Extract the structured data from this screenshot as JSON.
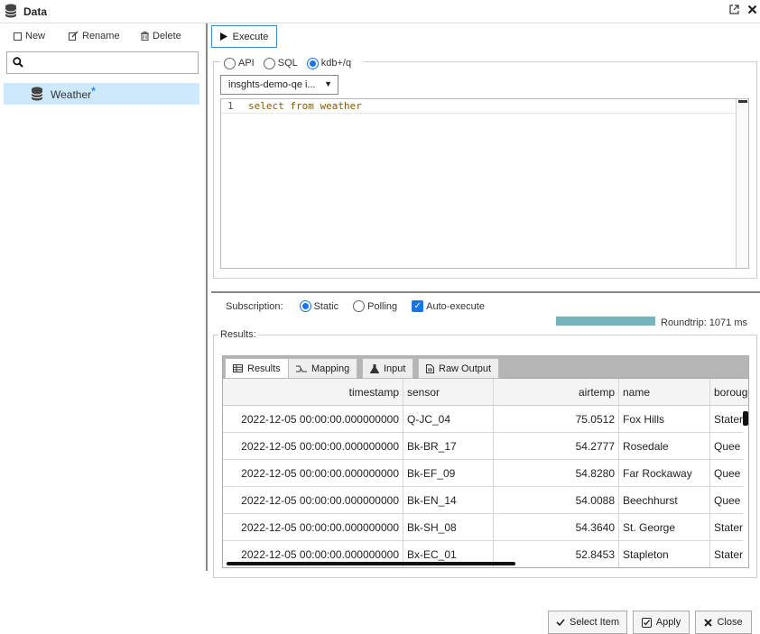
{
  "window": {
    "title": "Data",
    "popout_icon": "external-link-icon",
    "close_icon": "close-icon"
  },
  "sidebar": {
    "toolbar": {
      "new_label": "New",
      "rename_label": "Rename",
      "delete_label": "Delete"
    },
    "search": {
      "value": "",
      "placeholder": ""
    },
    "items": [
      {
        "label": "Weather",
        "modified_marker": "*",
        "icon": "database-icon",
        "selected": true
      }
    ]
  },
  "query": {
    "execute_label": "Execute",
    "modes": [
      {
        "label": "API",
        "selected": false
      },
      {
        "label": "SQL",
        "selected": false
      },
      {
        "label": "kdb+/q",
        "selected": true
      }
    ],
    "connection": "insghts-demo-qe i...",
    "editor": {
      "line_number": "1",
      "code": "select from weather"
    }
  },
  "subscription": {
    "label": "Subscription:",
    "static_label": "Static",
    "polling_label": "Polling",
    "mode": "Static",
    "auto_execute_label": "Auto-execute",
    "auto_execute_checked": true,
    "progress_percent": 100,
    "roundtrip": "Roundtrip: 1071 ms"
  },
  "results": {
    "legend": "Results:",
    "tabs": [
      {
        "label": "Results",
        "icon": "table-icon",
        "active": true
      },
      {
        "label": "Mapping",
        "icon": "mapping-icon",
        "active": false
      },
      {
        "label": "Input",
        "icon": "flask-icon",
        "active": false
      },
      {
        "label": "Raw Output",
        "icon": "document-icon",
        "active": false
      }
    ],
    "columns": [
      "timestamp",
      "sensor",
      "airtemp",
      "name",
      "boroug"
    ],
    "rows": [
      [
        "2022-12-05 00:00:00.000000000",
        "Q-JC_04",
        "75.0512",
        "Fox Hills",
        "Stater"
      ],
      [
        "2022-12-05 00:00:00.000000000",
        "Bk-BR_17",
        "54.2777",
        "Rosedale",
        "Quee"
      ],
      [
        "2022-12-05 00:00:00.000000000",
        "Bk-EF_09",
        "54.8280",
        "Far Rockaway",
        "Quee"
      ],
      [
        "2022-12-05 00:00:00.000000000",
        "Bk-EN_14",
        "54.0088",
        "Beechhurst",
        "Quee"
      ],
      [
        "2022-12-05 00:00:00.000000000",
        "Bk-SH_08",
        "54.3640",
        "St. George",
        "Stater"
      ],
      [
        "2022-12-05 00:00:00.000000000",
        "Bx-EC_01",
        "52.8453",
        "Stapleton",
        "Stater"
      ]
    ]
  },
  "footer": {
    "select_label": "Select Item",
    "apply_label": "Apply",
    "close_label": "Close"
  },
  "colors": {
    "accent": "#1a73e8",
    "selection": "#cde9fb",
    "progress": "#78b4bc",
    "code": "#8a5a00"
  }
}
